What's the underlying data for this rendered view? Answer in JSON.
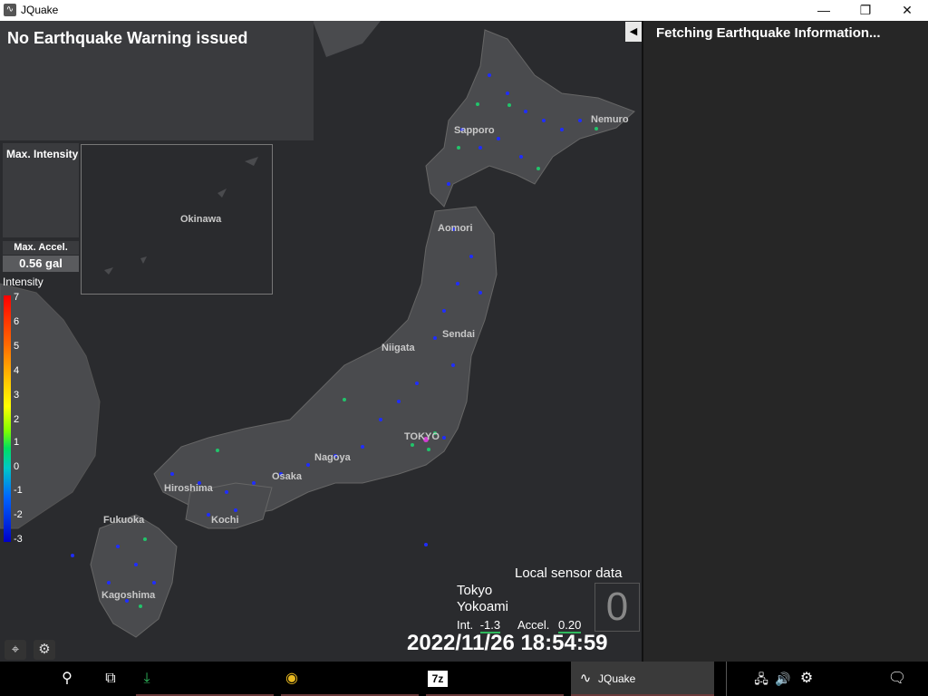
{
  "window": {
    "title": "JQuake",
    "min_glyph": "—",
    "max_glyph": "❐",
    "close_glyph": "✕"
  },
  "warning": {
    "text": "No Earthquake Warning issued"
  },
  "max_intensity": {
    "label": "Max. Intensity"
  },
  "max_accel": {
    "label": "Max. Accel.",
    "value": "0.56 gal"
  },
  "scale": {
    "title": "Intensity",
    "labels": [
      "7",
      "6",
      "5",
      "4",
      "3",
      "2",
      "1",
      "0",
      "-1",
      "-2",
      "-3"
    ]
  },
  "map_labels": {
    "sapporo": "Sapporo",
    "nemuro": "Nemuro",
    "aomori": "Aomori",
    "sendai": "Sendai",
    "niigata": "Niigata",
    "tokyo": "TOKYO",
    "nagoya": "Nagoya",
    "osaka": "Osaka",
    "hiroshima": "Hiroshima",
    "kochi": "Kochi",
    "fukuoka": "Fukuoka",
    "kagoshima": "Kagoshima",
    "okinawa": "Okinawa"
  },
  "right_panel": {
    "status": "Fetching Earthquake Information...",
    "collapse_glyph": "◀"
  },
  "local_sensor": {
    "title": "Local sensor data",
    "city": "Tokyo",
    "area": "Yokoami",
    "int_label": "Int.",
    "int_value": "-1.3",
    "accel_label": "Accel.",
    "accel_value": "0.20",
    "big_intensity": "0"
  },
  "datetime": "2022/11/26 18:54:59",
  "map_controls": {
    "locate_glyph": "⌖",
    "settings_glyph": "⚙"
  },
  "taskbar": {
    "search_glyph": "⚲",
    "taskview_glyph": "⧉",
    "download_glyph": "⤓",
    "chrome_glyph": "◉",
    "sevenzip_label": "7z",
    "jquake_label": "JQuake",
    "network_glyph": "🖧",
    "volume_glyph": "🔊",
    "settings_glyph": "⚙",
    "notification_glyph": "🗨"
  },
  "colors": {
    "panel_bg": "#262626",
    "map_bg": "#2a2b2e",
    "land": "#4a4b4e",
    "sensor_blue": "#1f2dff",
    "sensor_green": "#21c46b",
    "accent_green": "#2fb95d"
  }
}
